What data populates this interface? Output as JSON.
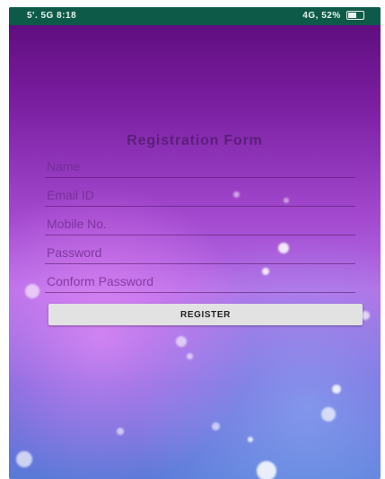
{
  "status_bar": {
    "left_text": "5'. 5G 8:18",
    "right_text": "4G, 52%"
  },
  "form": {
    "title": "Registration Form",
    "fields": [
      {
        "placeholder": "Name",
        "value": ""
      },
      {
        "placeholder": "Email ID",
        "value": ""
      },
      {
        "placeholder": "Mobile No.",
        "value": ""
      },
      {
        "placeholder": "Password",
        "value": ""
      },
      {
        "placeholder": "Conform Password",
        "value": ""
      }
    ],
    "register_label": "REGISTER"
  },
  "colors": {
    "status_bar_bg": "#0e5a49",
    "title_color": "#5c1f7a",
    "button_bg": "#e2e2e2"
  }
}
